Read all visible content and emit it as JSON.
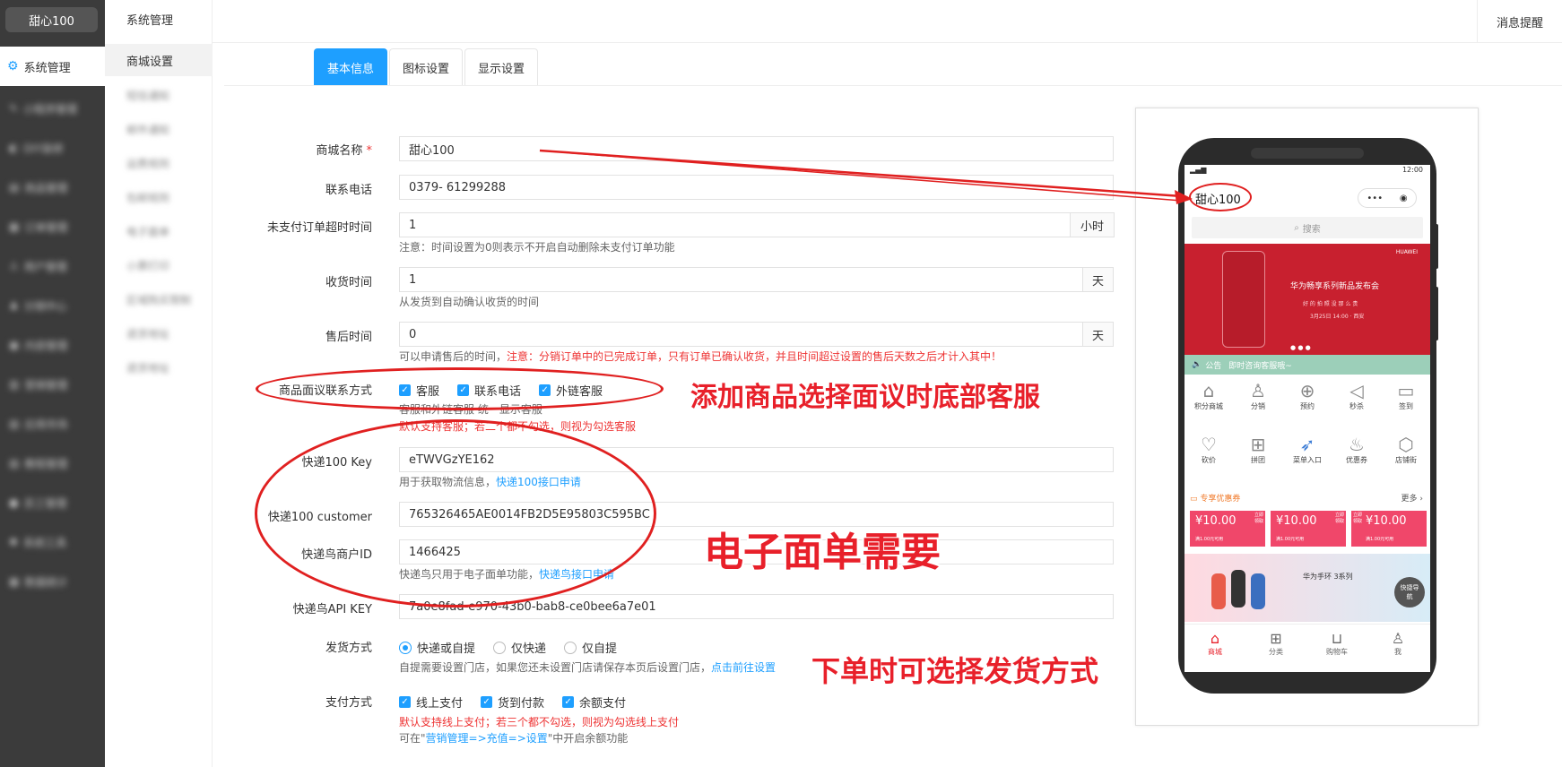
{
  "sidebar": {
    "logo": "甜心100",
    "active": "系统管理",
    "items": [
      "小程序管理",
      "DIY装修",
      "商品管理",
      "订单管理",
      "用户管理",
      "分销中心",
      "内容管理",
      "营销管理",
      "应用市场",
      "教程管理",
      "员工管理",
      "系统工具",
      "数据统计"
    ]
  },
  "subnav": {
    "title": "系统管理",
    "active": "商城设置",
    "items": [
      "短信通知",
      "邮件通知",
      "运费规则",
      "包邮规则",
      "电子面单",
      "小票打印",
      "区域购买限制",
      "退货地址",
      "退货地址"
    ]
  },
  "topbar": {
    "message": "消息提醒"
  },
  "tabs": [
    "基本信息",
    "图标设置",
    "显示设置"
  ],
  "form": {
    "shop_name": {
      "label": "商城名称",
      "required": "*",
      "value": "甜心100"
    },
    "phone": {
      "label": "联系电话",
      "value": "0379- 61299288"
    },
    "unpaid_timeout": {
      "label": "未支付订单超时时间",
      "value": "1",
      "unit": "小时",
      "note": "注意：时间设置为0则表示不开启自动删除未支付订单功能"
    },
    "receive_time": {
      "label": "收货时间",
      "value": "1",
      "unit": "天",
      "note": "从发货到自动确认收货的时间"
    },
    "aftersale_time": {
      "label": "售后时间",
      "value": "0",
      "unit": "天",
      "note_black": "可以申请售后的时间，",
      "note_red": "注意：分销订单中的已完成订单，只有订单已确认收货，并且时间超过设置的售后天数之后才计入其中！"
    },
    "negotiable_contact": {
      "label": "商品面议联系方式",
      "options": [
        "客服",
        "联系电话",
        "外链客服"
      ],
      "note1": "客服和外链客服 统一显示客服",
      "note2": "默认支持客服；若二个都不勾选，则视为勾选客服"
    },
    "kuaidi100_key": {
      "label": "快递100 Key",
      "value": "eTWVGzYE162",
      "note": "用于获取物流信息，",
      "note_link": "快递100接口申请"
    },
    "kuaidi100_customer": {
      "label": "快递100 customer",
      "value": "765326465AE0014FB2D5E95803C595BC"
    },
    "kdniao_id": {
      "label": "快递鸟商户ID",
      "value": "1466425",
      "note": "快递鸟只用于电子面单功能，",
      "note_link": "快递鸟接口申请"
    },
    "kdniao_key": {
      "label": "快递鸟API KEY",
      "value": "7a0e8fad-e970-43b0-bab8-ce0bee6a7e01"
    },
    "delivery": {
      "label": "发货方式",
      "options": [
        "快递或自提",
        "仅快递",
        "仅自提"
      ],
      "selected": "快递或自提",
      "note": "自提需要设置门店，如果您还未设置门店请保存本页后设置门店，",
      "note_link": "点击前往设置"
    },
    "payment": {
      "label": "支付方式",
      "options": [
        "线上支付",
        "货到付款",
        "余额支付"
      ],
      "note_red": "默认支持线上支付；若三个都不勾选，则视为勾选线上支付",
      "note3a": "可在\"",
      "note3_link": "营销管理=>充值=>设置",
      "note3b": "\"中开启余额功能"
    }
  },
  "annotations": {
    "a1": "添加商品选择面议时底部客服",
    "a2": "电子面单需要",
    "a3": "下单时可选择发货方式"
  },
  "phone": {
    "status_time": "12:00",
    "title": "甜心100",
    "search": "搜索",
    "banner": {
      "brand": "HUAWEI",
      "title": "华为畅享系列新品发布会",
      "sub": "好 的 拍 照 没 那 么 贵",
      "date": "3月25日 14:00 · 西安"
    },
    "notice_label": "公告",
    "notice": "即时咨询客服哦~",
    "grid": [
      "积分商城",
      "分销",
      "预约",
      "秒杀",
      "签到",
      "砍价",
      "拼团",
      "菜单入口",
      "优惠券",
      "店铺街"
    ],
    "coupon_title": "专享优惠券",
    "coupon_more": "更多 ›",
    "coupon_value": "¥10.00",
    "coupon_cond": "满1.00元可用",
    "coupon_btn": "立即领取",
    "ad_title": "华为手环 3系列",
    "ad_btn": "快捷导航",
    "tabbar": [
      "商城",
      "分类",
      "购物车",
      "我"
    ]
  },
  "colors": {
    "accent": "#1e9fff",
    "annotation": "#e8202a",
    "banner": "#c8202f",
    "coupon": "#f0476a"
  }
}
